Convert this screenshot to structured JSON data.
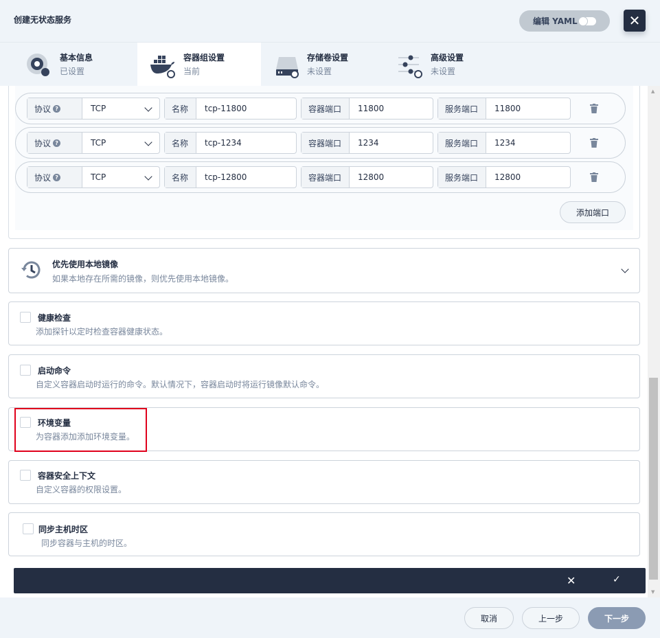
{
  "header": {
    "title": "创建无状态服务",
    "yaml_label": "编辑 YAML",
    "close_symbol": "✕"
  },
  "steps": [
    {
      "name": "基本信息",
      "status": "已设置",
      "icon": "disc-icon"
    },
    {
      "name": "容器组设置",
      "status": "当前",
      "icon": "docker-icon"
    },
    {
      "name": "存储卷设置",
      "status": "未设置",
      "icon": "storage-icon"
    },
    {
      "name": "高级设置",
      "status": "未设置",
      "icon": "sliders-icon"
    }
  ],
  "ports": {
    "protocol_label": "协议",
    "name_label": "名称",
    "container_port_label": "容器端口",
    "service_port_label": "服务端口",
    "help_symbol": "?",
    "rows": [
      {
        "protocol": "TCP",
        "name": "tcp-11800",
        "container_port": "11800",
        "service_port": "11800"
      },
      {
        "protocol": "TCP",
        "name": "tcp-1234",
        "container_port": "1234",
        "service_port": "1234"
      },
      {
        "protocol": "TCP",
        "name": "tcp-12800",
        "container_port": "12800",
        "service_port": "12800"
      }
    ],
    "add_label": "添加端口"
  },
  "local_image": {
    "title": "优先使用本地镜像",
    "description": "如果本地存在所需的镜像，则优先使用本地镜像。"
  },
  "options": [
    {
      "title": "健康检查",
      "description": "添加探针以定时检查容器健康状态。"
    },
    {
      "title": "启动命令",
      "description": "自定义容器启动时运行的命令。默认情况下，容器启动时将运行镜像默认命令。"
    },
    {
      "title": "环境变量",
      "description": "为容器添加添加环境变量。"
    },
    {
      "title": "容器安全上下文",
      "description": "自定义容器的权限设置。"
    },
    {
      "title": "同步主机时区",
      "description": "同步容器与主机的时区。"
    }
  ],
  "action_bar": {
    "cancel_symbol": "✕",
    "confirm_symbol": "✓"
  },
  "footer": {
    "cancel": "取消",
    "prev": "上一步",
    "next": "下一步"
  },
  "scrollbar": {
    "up_symbol": "▲",
    "down_symbol": "▼"
  },
  "colors": {
    "dark": "#242e42",
    "muted": "#79879c",
    "highlight": "#e0001b",
    "primary_disabled": "#8b9bb3"
  }
}
